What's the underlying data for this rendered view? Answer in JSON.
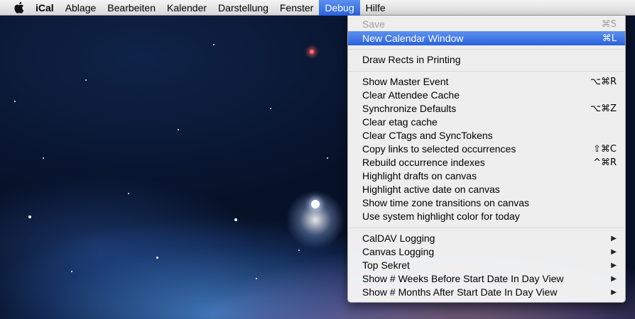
{
  "menubar": {
    "apple": "apple-icon",
    "app_name": "iCal",
    "menus": [
      "Ablage",
      "Bearbeiten",
      "Kalender",
      "Darstellung",
      "Fenster",
      "Debug",
      "Hilfe"
    ]
  },
  "debug_menu": {
    "save": {
      "label": "Save",
      "shortcut": "⌘S"
    },
    "new_calendar_window": {
      "label": "New Calendar Window",
      "shortcut": "⌘L"
    },
    "draw_rects": {
      "label": "Draw Rects in Printing"
    },
    "items": [
      {
        "label": "Show Master Event",
        "shortcut": "⌥⌘R"
      },
      {
        "label": "Clear Attendee Cache",
        "shortcut": ""
      },
      {
        "label": "Synchronize Defaults",
        "shortcut": "⌥⌘Z"
      },
      {
        "label": "Clear etag cache",
        "shortcut": ""
      },
      {
        "label": "Clear CTags and SyncTokens",
        "shortcut": ""
      },
      {
        "label": "Copy links to selected occurrences",
        "shortcut": "⇧⌘C"
      },
      {
        "label": "Rebuild occurrence indexes",
        "shortcut": "^⌘R"
      },
      {
        "label": "Highlight drafts on canvas",
        "shortcut": ""
      },
      {
        "label": "Highlight active date on canvas",
        "shortcut": ""
      },
      {
        "label": "Show time zone transitions on canvas",
        "shortcut": ""
      },
      {
        "label": "Use system highlight color for today",
        "shortcut": ""
      }
    ],
    "submenus": [
      {
        "label": "CalDAV Logging",
        "arrow": "▶"
      },
      {
        "label": "Canvas Logging",
        "arrow": "▶"
      },
      {
        "label": "Top Sekret",
        "arrow": "▶"
      },
      {
        "label": "Show # Weeks Before Start Date In Day View",
        "arrow": "▶"
      },
      {
        "label": "Show # Months After Start Date In Day View",
        "arrow": "▶"
      }
    ]
  },
  "colors": {
    "highlight": "#2a62dc",
    "menubar": "#e6e6e6",
    "disabled_text": "#a0a0a0"
  }
}
